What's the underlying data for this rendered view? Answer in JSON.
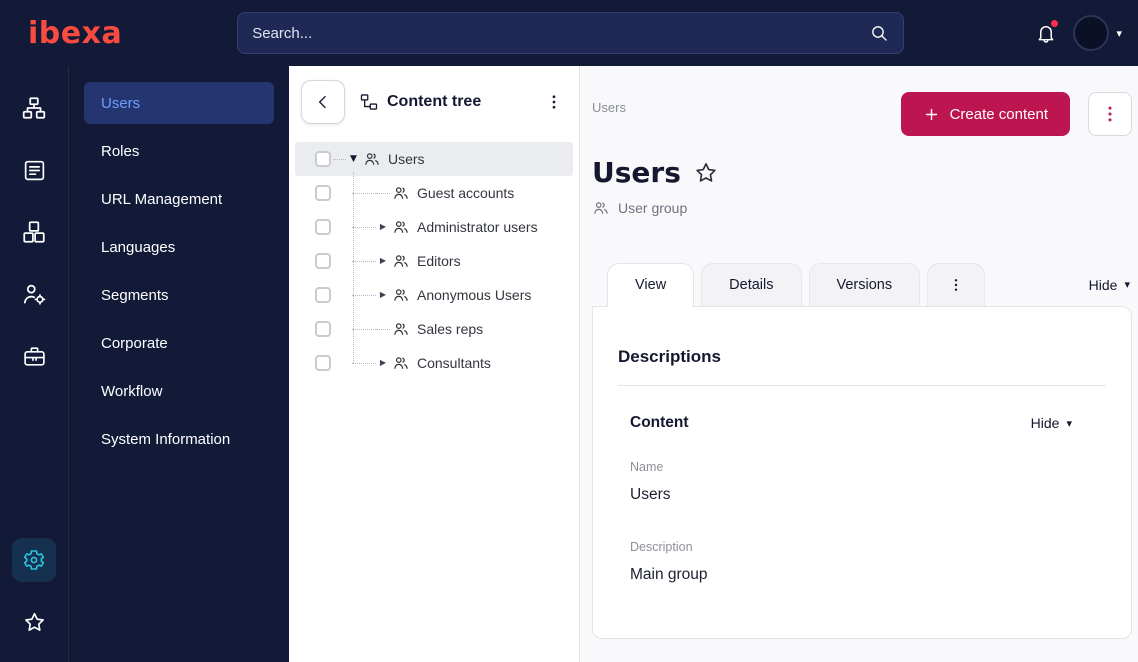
{
  "topbar": {
    "logo_text": "ibexa",
    "search_placeholder": "Search..."
  },
  "sidebar": {
    "active_item": "Users",
    "items": [
      "Users",
      "Roles",
      "URL Management",
      "Languages",
      "Segments",
      "Corporate",
      "Workflow",
      "System Information"
    ]
  },
  "content_tree": {
    "title": "Content tree",
    "items": [
      {
        "label": "Users",
        "expanded": true,
        "selected": true
      },
      {
        "label": "Guest accounts",
        "expandable": false
      },
      {
        "label": "Administrator users",
        "expandable": true
      },
      {
        "label": "Editors",
        "expandable": true
      },
      {
        "label": "Anonymous Users",
        "expandable": true
      },
      {
        "label": "Sales reps",
        "expandable": false
      },
      {
        "label": "Consultants",
        "expandable": true
      }
    ]
  },
  "main": {
    "breadcrumb": "Users",
    "create_button_label": "Create content",
    "title": "Users",
    "content_type_label": "User group",
    "tabs": [
      "View",
      "Details",
      "Versions"
    ],
    "hide_label": "Hide",
    "card": {
      "section_title": "Descriptions",
      "group_title": "Content",
      "hide_label": "Hide",
      "fields": [
        {
          "label": "Name",
          "value": "Users"
        },
        {
          "label": "Description",
          "value": "Main group"
        }
      ]
    }
  },
  "icons": {
    "caret_down": "▾",
    "caret_expanded": "▼",
    "caret_collapsed": "▶"
  },
  "colors": {
    "navy": "#121a38",
    "logo_red": "#fa4b41",
    "primary_magenta": "#bd1550",
    "active_item_bg": "#24356f",
    "active_item_text": "#6d9eff",
    "settings_teal": "#2fc1dd",
    "notification_red": "#ff2d4d"
  }
}
